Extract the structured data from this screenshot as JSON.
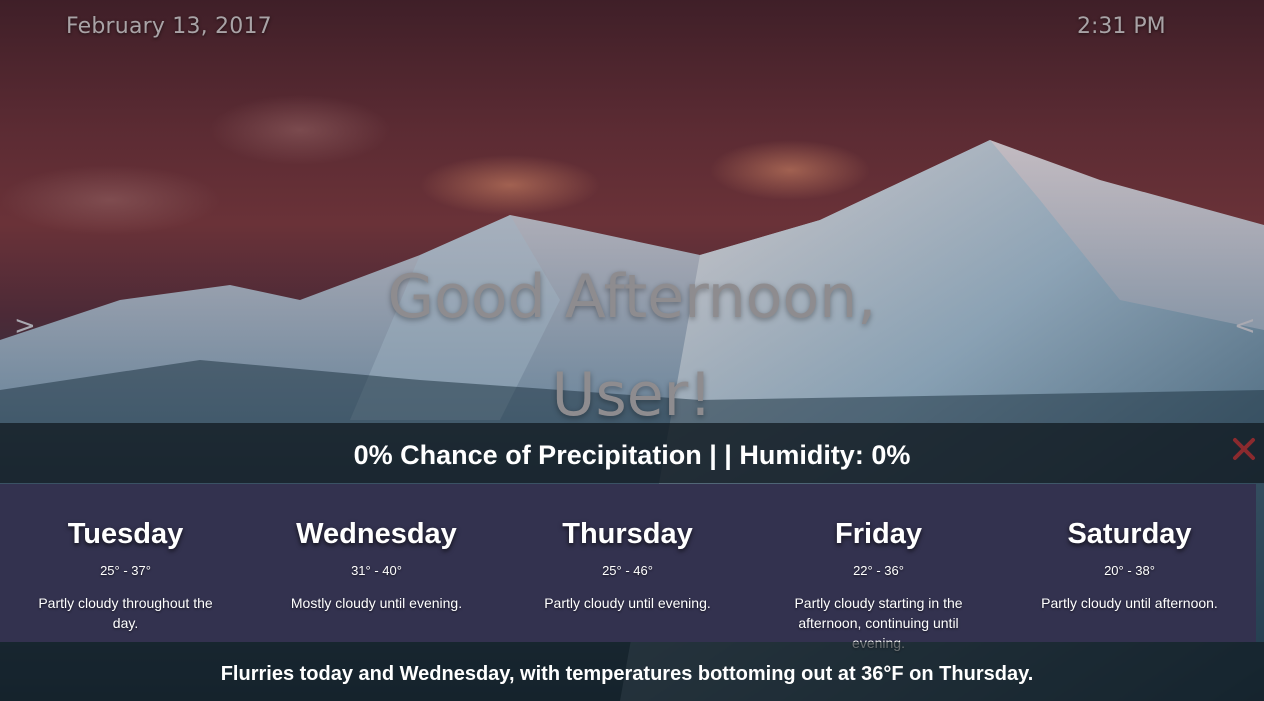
{
  "header": {
    "date": "February 13, 2017",
    "time": "2:31 PM"
  },
  "greeting": {
    "line1": "Good Afternoon,",
    "line2": "User!"
  },
  "nav": {
    "prev_label": ">",
    "next_label": "<"
  },
  "current": {
    "details": "0% Chance of Precipitation | | Humidity: 0%"
  },
  "forecast": [
    {
      "day": "Tuesday",
      "temps": "25° - 37°",
      "summary": "Partly cloudy throughout the day."
    },
    {
      "day": "Wednesday",
      "temps": "31° - 40°",
      "summary": "Mostly cloudy until evening."
    },
    {
      "day": "Thursday",
      "temps": "25° - 46°",
      "summary": "Partly cloudy until evening."
    },
    {
      "day": "Friday",
      "temps": "22° - 36°",
      "summary": "Partly cloudy starting in the afternoon, continuing until evening."
    },
    {
      "day": "Saturday",
      "temps": "20° - 38°",
      "summary": "Partly cloudy until afternoon."
    }
  ],
  "weekly_summary": "Flurries today and Wednesday, with temperatures bottoming out at 36°F on Thursday.",
  "icons": {
    "close": "close-icon"
  },
  "colors": {
    "close": "#8b2a2e",
    "forecast_panel": "#33324f",
    "text": "#ffffff"
  }
}
